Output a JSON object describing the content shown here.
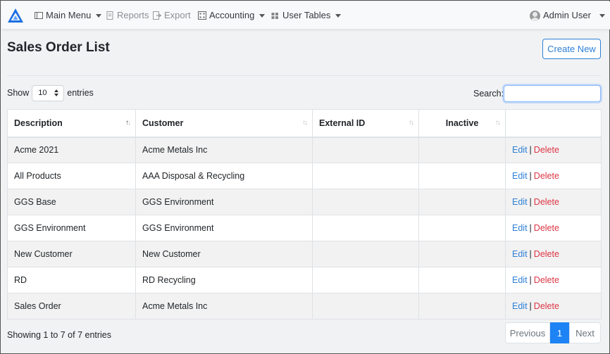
{
  "nav": {
    "main_menu": "Main Menu",
    "reports": "Reports",
    "export": "Export",
    "accounting": "Accounting",
    "user_tables": "User Tables",
    "user": "Admin User"
  },
  "page": {
    "title": "Sales Order List",
    "create_button": "Create New"
  },
  "controls": {
    "show_label": "Show",
    "page_size": "10",
    "entries_label": "entries",
    "search_label": "Search:",
    "search_value": ""
  },
  "table": {
    "headers": [
      "Description",
      "Customer",
      "External ID",
      "Inactive",
      ""
    ],
    "rows": [
      {
        "description": "Acme 2021",
        "customer": "Acme Metals Inc",
        "external_id": "",
        "inactive": ""
      },
      {
        "description": "All Products",
        "customer": "AAA Disposal & Recycling",
        "external_id": "",
        "inactive": ""
      },
      {
        "description": "GGS Base",
        "customer": "GGS Environment",
        "external_id": "",
        "inactive": ""
      },
      {
        "description": "GGS Environment",
        "customer": "GGS Environment",
        "external_id": "",
        "inactive": ""
      },
      {
        "description": "New Customer",
        "customer": "New Customer",
        "external_id": "",
        "inactive": ""
      },
      {
        "description": "RD",
        "customer": "RD Recycling",
        "external_id": "",
        "inactive": ""
      },
      {
        "description": "Sales Order",
        "customer": "Acme Metals Inc",
        "external_id": "",
        "inactive": ""
      }
    ],
    "edit_label": "Edit",
    "separator": "|",
    "delete_label": "Delete"
  },
  "footer": {
    "info": "Showing 1 to 7 of 7 entries",
    "previous": "Previous",
    "current_page": "1",
    "next": "Next"
  },
  "colors": {
    "primary": "#2d7fd6",
    "danger": "#dc3545",
    "active_page": "#1e83f5"
  }
}
